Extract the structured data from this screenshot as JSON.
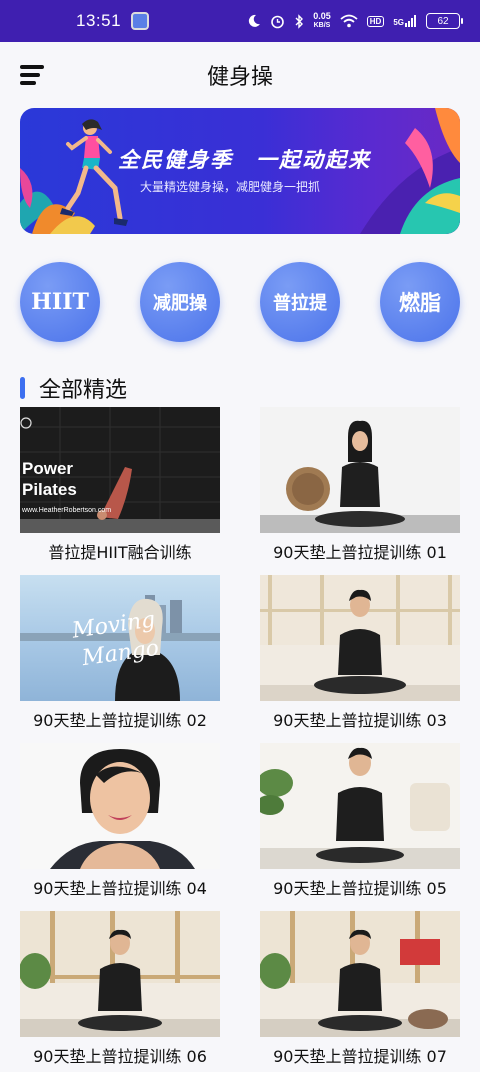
{
  "status_bar": {
    "time": "13:51",
    "net_speed_value": "0.05",
    "net_speed_unit": "KB/S",
    "hd_badge": "HD",
    "signal_label": "5G",
    "battery": "62"
  },
  "header": {
    "title": "健身操"
  },
  "banner": {
    "title": "全民健身季　一起动起来",
    "subtitle": "大量精选健身操，减肥健身一把抓"
  },
  "categories": [
    {
      "label": "HIIT"
    },
    {
      "label": "减肥操"
    },
    {
      "label": "普拉提"
    },
    {
      "label": "燃脂"
    }
  ],
  "section": {
    "title": "全部精选"
  },
  "videos": [
    {
      "title": "普拉提HIIT融合训练",
      "overlay_line1": "Power",
      "overlay_line2": "Pilates",
      "overlay_url": "www.HeatherRobertson.com"
    },
    {
      "title": "90天垫上普拉提训练 01"
    },
    {
      "title": "90天垫上普拉提训练 02",
      "overlay_line1": "Moving",
      "overlay_line2": "Mango"
    },
    {
      "title": "90天垫上普拉提训练 03"
    },
    {
      "title": "90天垫上普拉提训练 04"
    },
    {
      "title": "90天垫上普拉提训练 05"
    },
    {
      "title": "90天垫上普拉提训练 06"
    },
    {
      "title": "90天垫上普拉提训练 07"
    }
  ],
  "colors": {
    "status_bar": "#3f1fb0",
    "accent": "#4b73ea",
    "banner": "#3a2fd6"
  }
}
